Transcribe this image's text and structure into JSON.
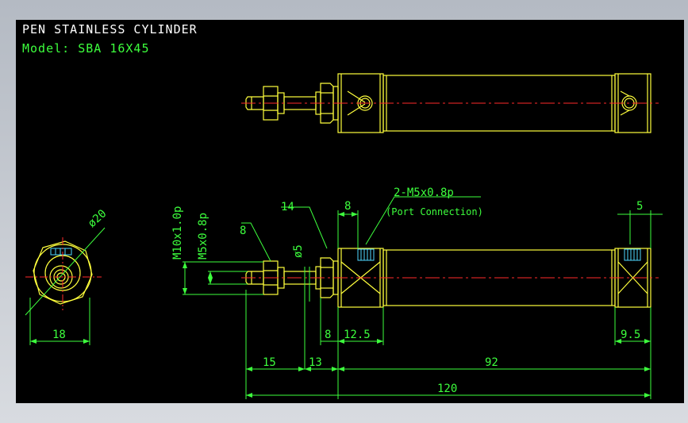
{
  "title": "PEN STAINLESS CYLINDER",
  "model": "Model: SBA 16X45",
  "colors": {
    "outline": "#ffff3c",
    "dimension": "#3dff3d",
    "centerline": "#ff2a2a",
    "port": "#4fd7ff",
    "text": "#ffffff",
    "background": "#000000"
  },
  "dims": {
    "d20": "ø20",
    "w18": "18",
    "m10": "M10x1.0p",
    "m5": "M5x0.8p",
    "n8a": "8",
    "n14": "14",
    "d5": "ø5",
    "n8b": "8",
    "port_thread": "2-M5x0.8p",
    "port_note": "(Port Connection)",
    "n5": "5",
    "n8c": "8",
    "n12_5": "12.5",
    "n9_5": "9.5",
    "n15": "15",
    "n13": "13",
    "n92": "92",
    "n120": "120"
  }
}
